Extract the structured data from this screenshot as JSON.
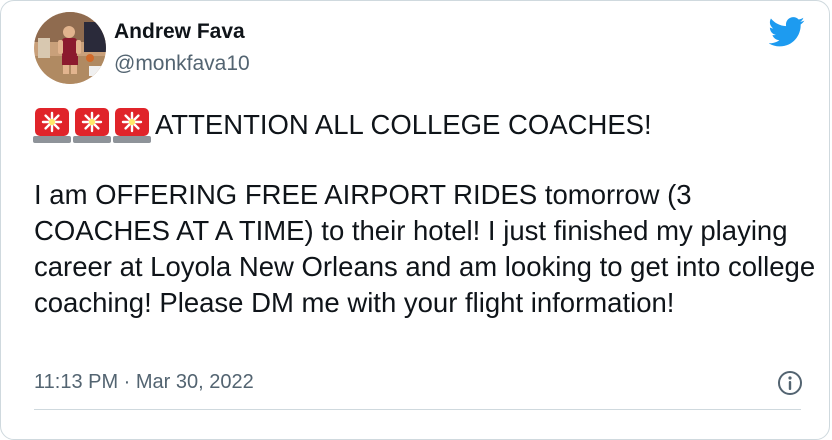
{
  "tweet": {
    "author_name": "Andrew Fava",
    "author_handle": "@monkfava10",
    "headline": "ATTENTION ALL COLLEGE COACHES!",
    "headline_emoji": [
      "police-car-light-icon",
      "police-car-light-icon",
      "police-car-light-icon"
    ],
    "body": "I am OFFERING FREE AIRPORT RIDES tomorrow (3 COACHES AT A TIME) to their hotel! I just finished my playing career at Loyola New Orleans and am looking to get into college coaching! Please DM me with your flight information!",
    "timestamp": "11:13 PM · Mar 30, 2022"
  },
  "icons": {
    "brand": "twitter-bird-icon",
    "info": "info-icon"
  },
  "colors": {
    "brand": "#1d9bf0",
    "text": "#0f1419",
    "secondary": "#536471",
    "siren": "#e0242a"
  }
}
